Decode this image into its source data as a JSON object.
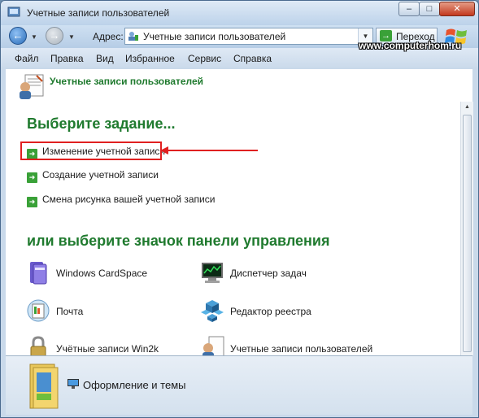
{
  "window": {
    "title": "Учетные записи пользователей",
    "minimize": "–",
    "maximize": "□",
    "close": "✕"
  },
  "address_bar": {
    "label": "Адрес:",
    "value": "Учетные записи пользователей",
    "go_label": "Переход"
  },
  "menu": [
    "Файл",
    "Правка",
    "Вид",
    "Избранное",
    "Сервис",
    "Справка"
  ],
  "watermark": "www.computerhom.ru",
  "panel": {
    "title": "Учетные записи пользователей",
    "task_heading": "Выберите задание...",
    "tasks": [
      "Изменение учетной записи",
      "Создание учетной записи",
      "Смена рисунка вашей учетной записи"
    ],
    "cp_heading": "или выберите значок панели управления",
    "cp_items": [
      {
        "label": "Windows CardSpace",
        "icon": "cardspace-icon"
      },
      {
        "label": "Диспетчер задач",
        "icon": "task-manager-icon"
      },
      {
        "label": "Почта",
        "icon": "mail-icon"
      },
      {
        "label": "Редактор реестра",
        "icon": "registry-editor-icon"
      },
      {
        "label": "Учётные записи Win2k",
        "icon": "win2k-accounts-icon"
      },
      {
        "label": "Учетные записи пользователей",
        "icon": "user-accounts-icon"
      }
    ]
  },
  "bottom": {
    "label": "Оформление и темы"
  },
  "colors": {
    "heading_green": "#1f7a2e",
    "highlight_red": "#e02020",
    "arrow_green": "#3aa138"
  }
}
